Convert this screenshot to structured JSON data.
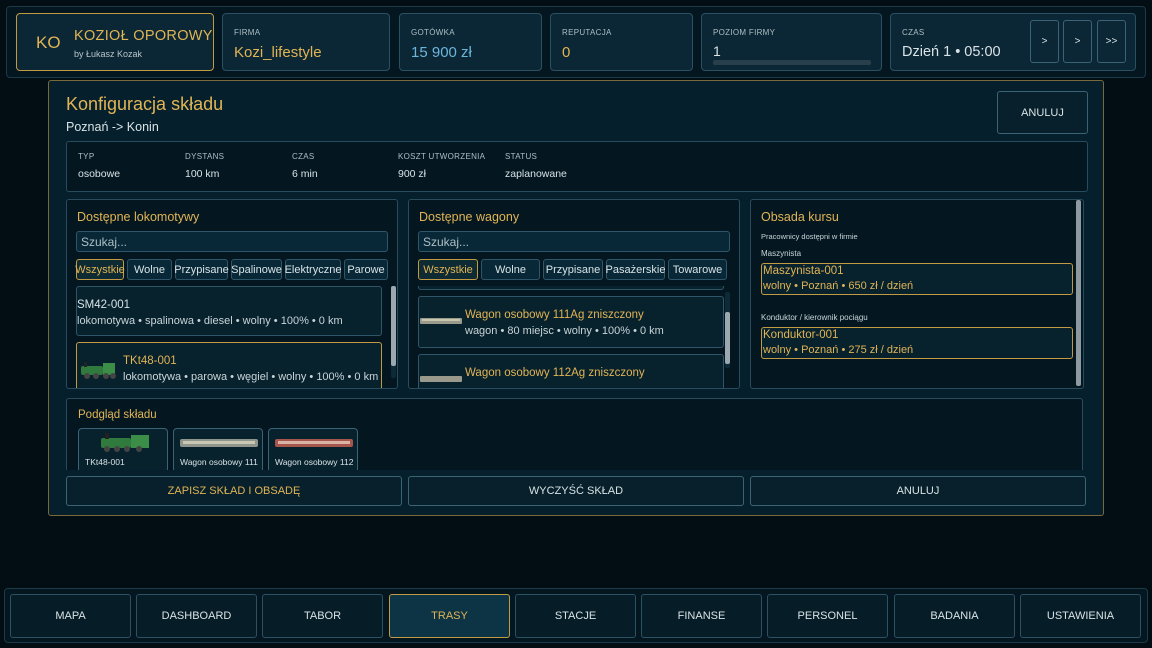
{
  "header": {
    "logo": {
      "initials": "KO",
      "title": "KOZIOŁ OPOROWY",
      "author": "by Łukasz Kozak"
    },
    "firm": {
      "label": "FIRMA",
      "value": "Kozi_lifestyle"
    },
    "cash": {
      "label": "GOTÓWKA",
      "value": "15 900 zł"
    },
    "reputation": {
      "label": "REPUTACJA",
      "value": "0"
    },
    "level": {
      "label": "POZIOM FIRMY",
      "value": "1",
      "progress": 0
    },
    "time": {
      "label": "CZAS",
      "value": "Dzień 1 • 05:00",
      "buttons": [
        ">",
        ">",
        ">>"
      ]
    }
  },
  "modal": {
    "title": "Konfiguracja składu",
    "route": "Poznań -> Konin",
    "cancel_top": "ANULUJ",
    "info": [
      {
        "label": "TYP",
        "value": "osobowe"
      },
      {
        "label": "DYSTANS",
        "value": "100 km"
      },
      {
        "label": "CZAS",
        "value": "6 min"
      },
      {
        "label": "KOSZT UTWORZENIA",
        "value": "900 zł"
      },
      {
        "label": "STATUS",
        "value": "zaplanowane"
      }
    ],
    "locomotives": {
      "title": "Dostępne lokomotywy",
      "search_placeholder": "Szukaj...",
      "filters": [
        "Wszystkie",
        "Wolne",
        "Przypisane",
        "Spalinowe",
        "Elektryczne",
        "Parowe"
      ],
      "active_filter": 0,
      "items": [
        {
          "name": "SM42-001",
          "desc": "lokomotywa • spalinowa • diesel • wolny • 100% • 0 km",
          "selected": false
        },
        {
          "name": "TKt48-001",
          "desc": "lokomotywa • parowa • węgiel • wolny • 100% • 0 km",
          "selected": true
        }
      ]
    },
    "wagons": {
      "title": "Dostępne wagony",
      "search_placeholder": "Szukaj...",
      "filters": [
        "Wszystkie",
        "Wolne",
        "Przypisane",
        "Pasażerskie",
        "Towarowe"
      ],
      "active_filter": 0,
      "items": [
        {
          "name": "Wagon osobowy 111Ag zniszczony",
          "desc": "wagon • 80 miejsc • wolny • 100% • 0 km"
        },
        {
          "name": "Wagon osobowy 112Ag zniszczony",
          "desc": ""
        }
      ]
    },
    "crew": {
      "title": "Obsada kursu",
      "subtitle": "Pracownicy dostępni w firmie",
      "roles": [
        {
          "label": "Maszynista",
          "name": "Maszynista-001",
          "desc": "wolny • Poznań • 650 zł / dzień"
        },
        {
          "label": "Konduktor / kierownik pociągu",
          "name": "Konduktor-001",
          "desc": "wolny • Poznań • 275 zł / dzień"
        }
      ]
    },
    "preview": {
      "title": "Podgląd składu",
      "cards": [
        "TKt48-001",
        "Wagon osobowy 111",
        "Wagon osobowy 112"
      ]
    },
    "actions": {
      "save": "ZAPISZ SKŁAD I OBSADĘ",
      "clear": "WYCZYŚĆ SKŁAD",
      "cancel": "ANULUJ"
    }
  },
  "nav": {
    "items": [
      "MAPA",
      "DASHBOARD",
      "TABOR",
      "TRASY",
      "STACJE",
      "FINANSE",
      "PERSONEL",
      "BADANIA",
      "USTAWIENIA"
    ],
    "active": 3
  },
  "colors": {
    "accent": "#e1b455",
    "background": "#020e14",
    "panel": "#061d28",
    "border": "#23485a"
  }
}
